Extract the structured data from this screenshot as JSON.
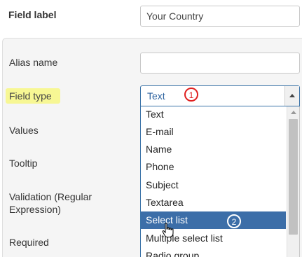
{
  "form": {
    "field_label": {
      "label": "Field label",
      "value": "Your Country"
    },
    "alias_name": {
      "label": "Alias name",
      "value": ""
    },
    "field_type": {
      "label": "Field type",
      "value": "Text"
    },
    "values": {
      "label": "Values"
    },
    "tooltip": {
      "label": "Tooltip"
    },
    "validation": {
      "label_line1": "Validation (Regular",
      "label_line2": "Expression)"
    },
    "required": {
      "label": "Required"
    }
  },
  "dropdown": {
    "options": [
      "Text",
      "E-mail",
      "Name",
      "Phone",
      "Subject",
      "Textarea",
      "Select list",
      "Multiple select list",
      "Radio group"
    ],
    "selected": "Select list"
  },
  "annotations": {
    "step1": "1",
    "step2": "2"
  },
  "colors": {
    "accent": "#3c6ea8",
    "highlight": "#f7f78a",
    "annotation_red": "#e02020"
  }
}
